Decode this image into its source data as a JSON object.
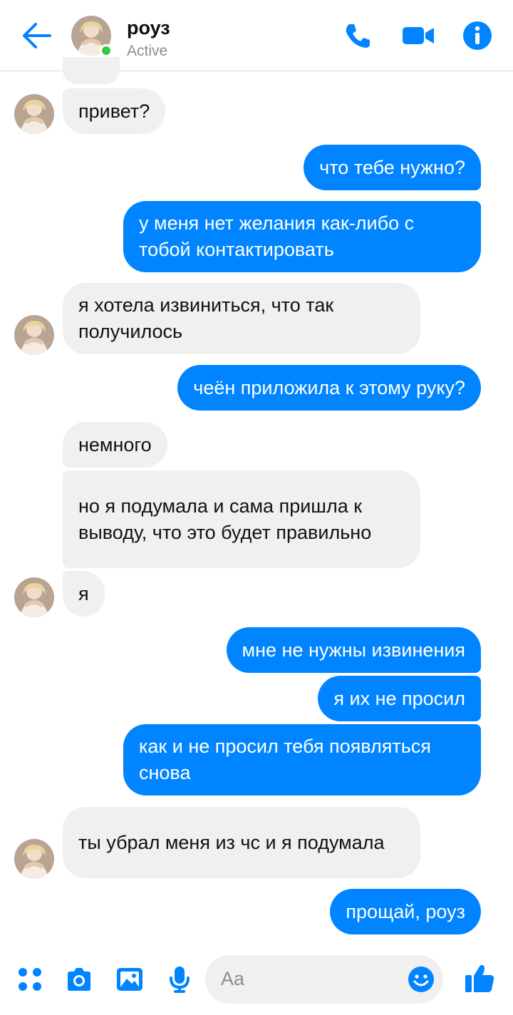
{
  "header": {
    "contact_name": "роуз",
    "status": "Active"
  },
  "messages": [
    {
      "side": "in",
      "text": "привет?"
    },
    {
      "side": "out",
      "text": "что тебе нужно?"
    },
    {
      "side": "out",
      "text": "у меня нет желания как-либо с тобой контактировать"
    },
    {
      "side": "in",
      "text": "я хотела извиниться, что так получилось"
    },
    {
      "side": "out",
      "text": "чеён приложила к этому руку?"
    },
    {
      "side": "in",
      "text": "немного"
    },
    {
      "side": "in",
      "text": "но я подумала и сама пришла к выводу, что это будет правильно"
    },
    {
      "side": "in",
      "text": "я"
    },
    {
      "side": "out",
      "text": "мне не нужны извинения"
    },
    {
      "side": "out",
      "text": "я их не просил"
    },
    {
      "side": "out",
      "text": "как и не просил тебя появляться снова"
    },
    {
      "side": "in",
      "text": "ты убрал меня из чс и я подумала"
    },
    {
      "side": "out",
      "text": "прощай, роуз"
    }
  ],
  "composer": {
    "placeholder": "Aa"
  },
  "colors": {
    "accent": "#0084ff",
    "incoming_bubble": "#f0f0f1",
    "online": "#31cc46"
  },
  "icons": [
    "back-arrow-icon",
    "phone-icon",
    "video-camera-icon",
    "info-icon",
    "apps-icon",
    "camera-icon",
    "gallery-icon",
    "microphone-icon",
    "emoji-icon",
    "thumbs-up-icon"
  ]
}
